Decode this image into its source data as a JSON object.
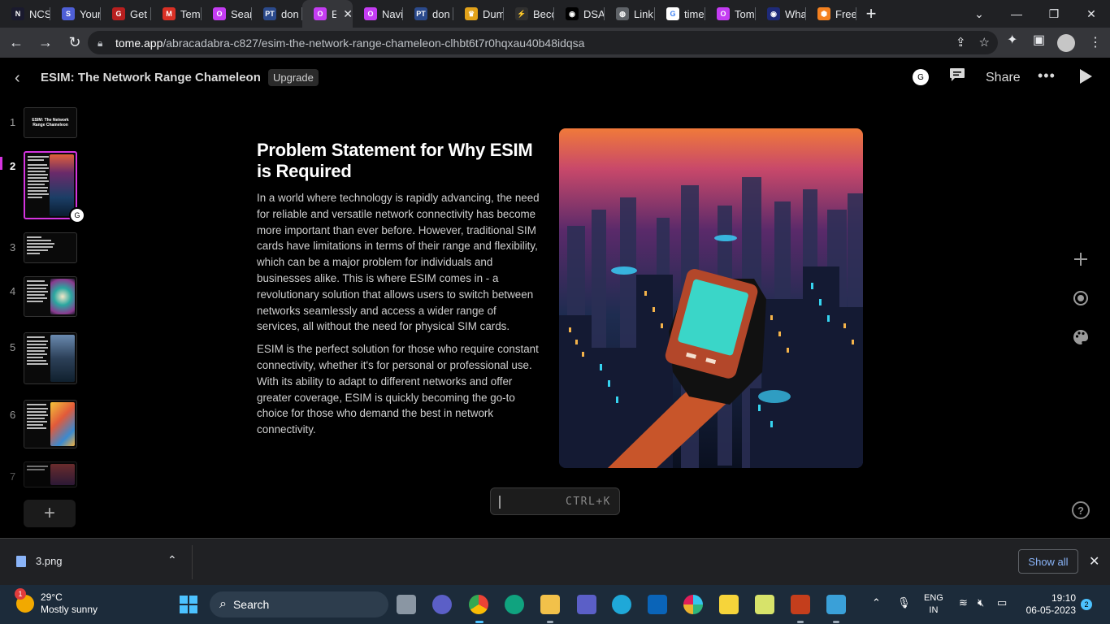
{
  "browser": {
    "tabs": [
      {
        "title": "NCS",
        "favicon_color": "#1a1a2e",
        "favicon_text": "N"
      },
      {
        "title": "Your",
        "favicon_color": "#4e5fd6",
        "favicon_text": "S"
      },
      {
        "title": "Get",
        "favicon_color": "#b81f1f",
        "favicon_text": "G"
      },
      {
        "title": "Tem",
        "favicon_color": "#d93025",
        "favicon_text": "M"
      },
      {
        "title": "Sear",
        "favicon_color": "#c43cf2",
        "favicon_text": "O"
      },
      {
        "title": "don",
        "favicon_color": "#2b4a8c",
        "favicon_text": "PT"
      },
      {
        "title": "E",
        "favicon_color": "#c43cf2",
        "favicon_text": "O",
        "active": true
      },
      {
        "title": "Navi",
        "favicon_color": "#c43cf2",
        "favicon_text": "O"
      },
      {
        "title": "don",
        "favicon_color": "#2b4a8c",
        "favicon_text": "PT"
      },
      {
        "title": "Dum",
        "favicon_color": "#e2a21a",
        "favicon_text": "♛"
      },
      {
        "title": "Becc",
        "favicon_color": "#303030",
        "favicon_text": "⚡"
      },
      {
        "title": "DSA",
        "favicon_color": "#000000",
        "favicon_text": "◉"
      },
      {
        "title": "Link",
        "favicon_color": "#5f6368",
        "favicon_text": "◍"
      },
      {
        "title": "time",
        "favicon_color": "#ffffff",
        "favicon_text": "G"
      },
      {
        "title": "Tom",
        "favicon_color": "#c43cf2",
        "favicon_text": "O"
      },
      {
        "title": "Wha",
        "favicon_color": "#1e2a78",
        "favicon_text": "◉"
      },
      {
        "title": "Free",
        "favicon_color": "#f48120",
        "favicon_text": "⬢"
      }
    ],
    "url_host": "tome.app",
    "url_path": "/abracadabra-c827/esim-the-network-range-chameleon-clhbt6t7r0hqxau40b48idqsa"
  },
  "app": {
    "doc_title": "ESIM: The Network Range Chameleon",
    "upgrade_label": "Upgrade",
    "avatar_letter": "G",
    "share_label": "Share",
    "more_label": "•••"
  },
  "sidebar": {
    "slides": [
      {
        "num": "1",
        "thumb_title": "ESIM: The Network Range Chameleon"
      },
      {
        "num": "2",
        "active": true
      },
      {
        "num": "3"
      },
      {
        "num": "4"
      },
      {
        "num": "5"
      },
      {
        "num": "6"
      },
      {
        "num": "7"
      }
    ],
    "thumb_avatar": "G",
    "add_label": "+"
  },
  "slide": {
    "title": "Problem Statement for Why ESIM is Required",
    "paragraphs": [
      "In a world where technology is rapidly advancing, the need for reliable and versatile network connectivity has become more important than ever before. However, traditional SIM cards have limitations in terms of their range and flexibility, which can be a major problem for individuals and businesses alike. This is where ESIM comes in - a revolutionary solution that allows users to switch between networks seamlessly and access a wider range of services, all without the need for physical SIM cards.",
      "ESIM is the perfect solution for those who require constant connectivity, whether it's for personal or professional use. With its ability to adapt to different networks and offer greater coverage, ESIM is quickly becoming the go-to choice for those who demand the best in network connectivity."
    ],
    "image_icon": "city-hand-phone-illustration"
  },
  "command": {
    "shortcut": "CTRL+K"
  },
  "downloads": {
    "file_name": "3.png",
    "show_all_label": "Show all"
  },
  "taskbar": {
    "weather_temp": "29°C",
    "weather_desc": "Mostly sunny",
    "weather_badge": "1",
    "search_label": "Search",
    "lang_line1": "ENG",
    "lang_line2": "IN",
    "time": "19:10",
    "date": "06-05-2023",
    "notif_count": "2"
  }
}
